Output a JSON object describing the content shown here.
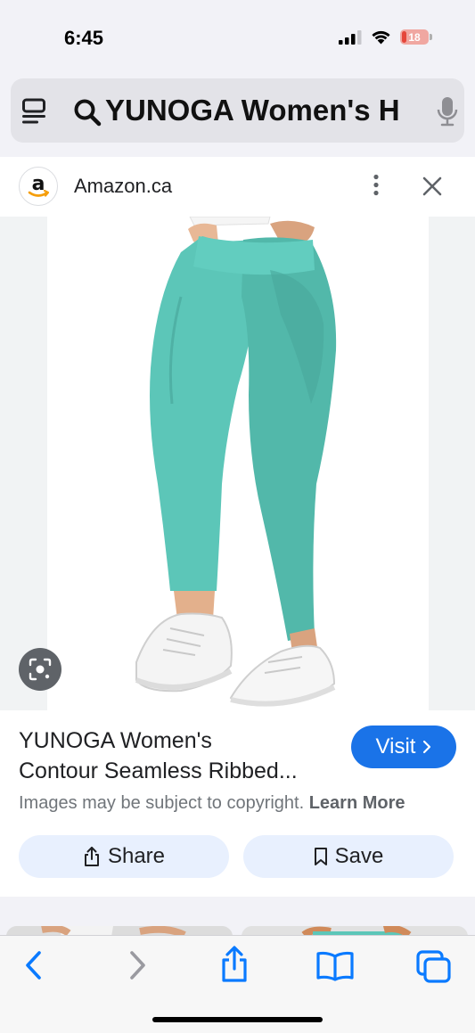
{
  "status_bar": {
    "time": "6:45",
    "battery_level": "18",
    "battery_fraction": 0.18
  },
  "search": {
    "query": "YUNOGA Women's H"
  },
  "result": {
    "source_name": "Amazon.ca",
    "source_logo_letter": "a",
    "title_line1": "YUNOGA Women's",
    "title_line2": "Contour Seamless Ribbed...",
    "visit_label": "Visit",
    "copyright_text": "Images may be subject to copyright.",
    "learn_more_label": "Learn More",
    "share_label": "Share",
    "save_label": "Save"
  },
  "colors": {
    "accent_blue": "#1a73e8",
    "safari_blue": "#0a7aff",
    "legging_teal": "#5cc6b8",
    "button_bg": "#e8f0fe",
    "battery_red": "#e5463b"
  },
  "icons": {
    "tabs_overview": "tabs-overview-icon",
    "search": "search-icon",
    "mic": "microphone-icon",
    "more": "more-vert-icon",
    "close": "close-icon",
    "lens": "lens-icon",
    "share": "share-icon",
    "bookmark": "bookmark-icon",
    "back": "back-chevron-icon",
    "forward": "forward-chevron-icon",
    "safari_share": "safari-share-icon",
    "book": "bookmarks-book-icon",
    "tabs": "tabs-icon"
  }
}
